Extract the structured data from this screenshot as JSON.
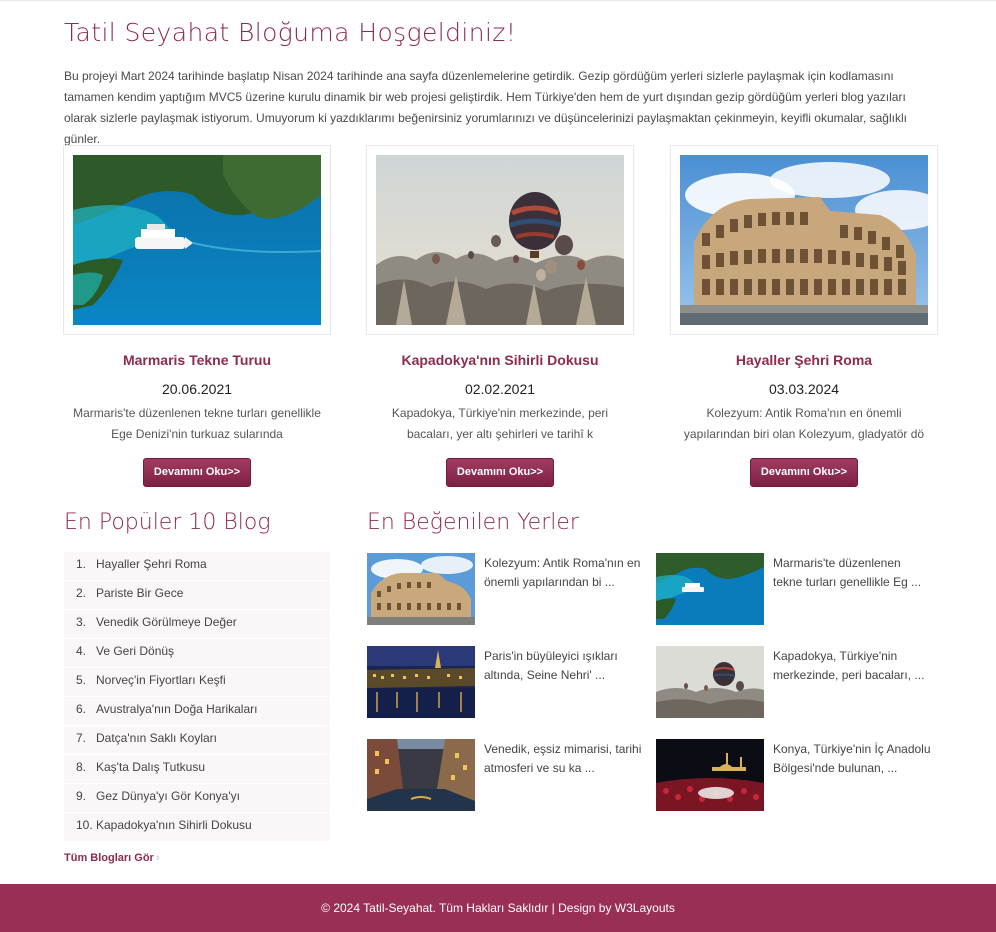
{
  "page": {
    "title": "Tatil Seyahat Bloğuma Hoşgeldiniz!",
    "intro": "Bu projeyi Mart 2024 tarihinde başlatıp Nisan 2024 tarihinde ana sayfa düzenlemelerine getirdik. Gezip gördüğüm yerleri sizlerle paylaşmak için kodlamasını tamamen kendim yaptığım MVC5 üzerine kurulu dinamik bir web projesi geliştirdik. Hem Türkiye'den hem de yurt dışından gezip gördüğüm yerleri blog yazıları olarak sizlerle paylaşmak istiyorum. Umuyorum ki yazdıklarımı beğenirsiniz yorumlarınızı ve düşüncelerinizi paylaşmaktan çekinmeyin, keyifli okumalar, sağlıklı günler."
  },
  "featured": [
    {
      "title": "Marmaris Tekne Turuu",
      "date": "20.06.2021",
      "excerpt": "Marmaris'te düzenlenen tekne turları genellikle Ege Denizi'nin turkuaz sularında",
      "button": "Devamını Oku>>",
      "image": "boat-bay-image"
    },
    {
      "title": "Kapadokya'nın Sihirli Dokusu",
      "date": "02.02.2021",
      "excerpt": "Kapadokya, Türkiye'nin merkezinde, peri bacaları, yer altı şehirleri ve tarihî k",
      "button": "Devamını Oku>>",
      "image": "balloons-image"
    },
    {
      "title": "Hayaller Şehri Roma",
      "date": "03.03.2024",
      "excerpt": "Kolezyum: Antik Roma'nın en önemli yapılarından biri olan Kolezyum, gladyatör dö",
      "button": "Devamını Oku>>",
      "image": "colosseum-image"
    }
  ],
  "popular": {
    "title": "En Popüler 10 Blog",
    "items": [
      {
        "num": "1.",
        "label": "Hayaller Şehri Roma"
      },
      {
        "num": "2.",
        "label": "Pariste Bir Gece"
      },
      {
        "num": "3.",
        "label": "Venedik Görülmeye Değer"
      },
      {
        "num": "4.",
        "label": "Ve Geri Dönüş"
      },
      {
        "num": "5.",
        "label": "Norveç'in Fiyortları Keşfi"
      },
      {
        "num": "6.",
        "label": "Avustralya'nın Doğa Harikaları"
      },
      {
        "num": "7.",
        "label": "Datça'nın Saklı Koyları"
      },
      {
        "num": "8.",
        "label": "Kaş'ta Dalış Tutkusu"
      },
      {
        "num": "9.",
        "label": "Gez Dünya'yı Gör Konya'yı"
      },
      {
        "num": "10.",
        "label": "Kapadokya'nın Sihirli Dokusu"
      }
    ],
    "all_link": "Tüm Blogları Gör",
    "chevron": "›"
  },
  "liked": {
    "title": "En Beğenilen Yerler",
    "items": [
      {
        "text": "Kolezyum: Antik Roma'nın en önemli yapılarından bi ...",
        "image": "colosseum-thumb"
      },
      {
        "text": "Marmaris'te düzenlenen tekne turları genellikle Eg ...",
        "image": "boat-thumb"
      },
      {
        "text": "Paris'in büyüleyici ışıkları altında, Seine Nehri' ...",
        "image": "paris-night-thumb"
      },
      {
        "text": "Kapadokya, Türkiye'nin merkezinde, peri bacaları, ...",
        "image": "balloons-thumb"
      },
      {
        "text": "Venedik, eşsiz mimarisi, tarihi atmosferi ve su ka ...",
        "image": "venice-thumb"
      },
      {
        "text": "Konya, Türkiye'nin İç Anadolu Bölgesi'nde bulunan, ...",
        "image": "konya-thumb"
      }
    ]
  },
  "footer": {
    "text": "© 2024 Tatil-Seyahat. Tüm Hakları Saklıdır | Design by W3Layouts"
  },
  "colors": {
    "accent": "#8e2a4e",
    "footer": "#9a2f55"
  }
}
